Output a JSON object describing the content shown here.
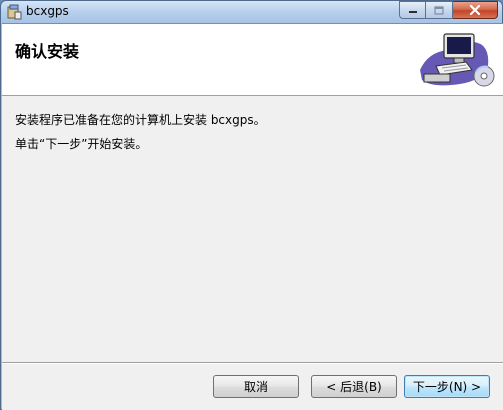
{
  "window": {
    "title": "bcxgps"
  },
  "banner": {
    "title": "确认安装"
  },
  "body": {
    "line1": "安装程序已准备在您的计算机上安装 bcxgps。",
    "line2": "单击“下一步”开始安装。"
  },
  "buttons": {
    "cancel": "取消",
    "back": "< 后退(B)",
    "next": "下一步(N) >"
  },
  "colors": {
    "titlebar": "#b7cfec",
    "client": "#f0f0f0",
    "close": "#c2452b",
    "default_button_border": "#3c7fb1"
  }
}
